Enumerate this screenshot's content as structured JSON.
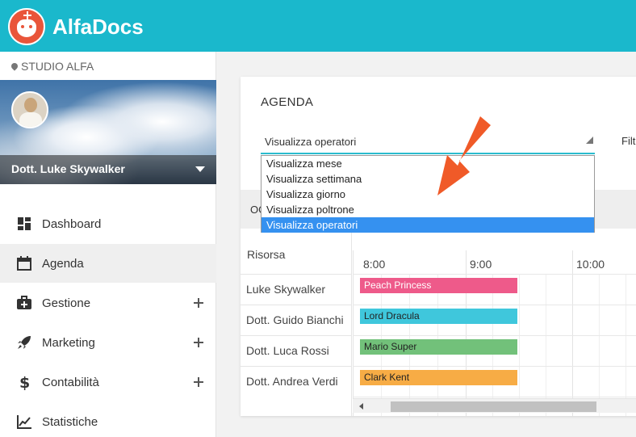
{
  "app": {
    "brand": "AlfaDocs"
  },
  "sidebar": {
    "studio": "STUDIO ALFA",
    "profile_name": "Dott. Luke Skywalker",
    "items": [
      {
        "label": "Dashboard",
        "icon": "dashboard-icon"
      },
      {
        "label": "Agenda",
        "icon": "calendar-icon",
        "active": true
      },
      {
        "label": "Gestione",
        "icon": "medkit-icon",
        "expandable": true
      },
      {
        "label": "Marketing",
        "icon": "rocket-icon",
        "expandable": true
      },
      {
        "label": "Contabilità",
        "icon": "dollar-icon",
        "expandable": true
      },
      {
        "label": "Statistiche",
        "icon": "chart-line-icon"
      }
    ]
  },
  "agenda": {
    "title": "AGENDA",
    "view_select": {
      "value": "Visualizza operatori",
      "options": [
        "Visualizza mese",
        "Visualizza settimana",
        "Visualizza giorno",
        "Visualizza poltrone",
        "Visualizza operatori"
      ],
      "selected_index": 4
    },
    "filter_label": "Filt",
    "toolbar_text": "OG",
    "resource_header": "Risorsa",
    "times": [
      "8:00",
      "9:00",
      "10:00"
    ],
    "resources": [
      "Luke Skywalker",
      "Dott. Guido Bianchi",
      "Dott. Luca Rossi",
      "Dott. Andrea Verdi"
    ],
    "events": [
      {
        "label": "Peach Princess",
        "color": "#ee5a8a"
      },
      {
        "label": "Lord Dracula",
        "color": "#3fc7dc"
      },
      {
        "label": "Mario Super",
        "color": "#72c17a"
      },
      {
        "label": "Clark Kent",
        "color": "#f7ac45"
      }
    ]
  },
  "colors": {
    "topbar": "#1ab8cc",
    "accent": "#2bbcce",
    "selected_option": "#3591f0",
    "arrow": "#f05a28"
  }
}
